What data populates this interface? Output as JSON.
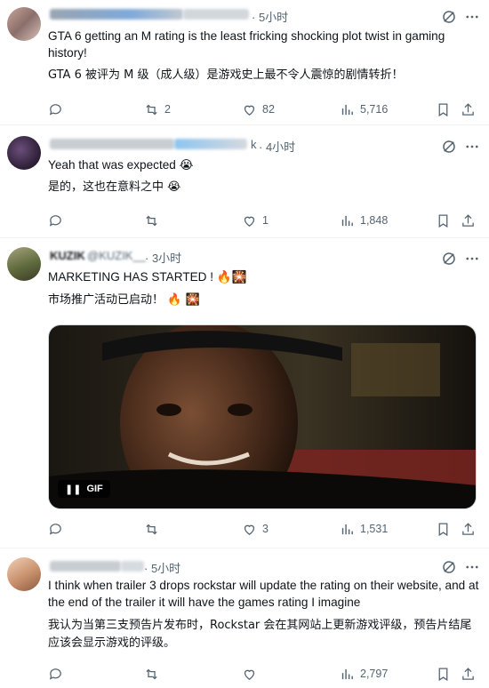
{
  "posts": [
    {
      "time": "· 5小时",
      "handle_partial": "Quantum",
      "text_en": "GTA 6 getting an M rating is the least fricking shocking plot twist in gaming history!",
      "text_cn": "GTA 6 被评为 M 级（成人级）是游戏史上最不令人震惊的剧情转折！",
      "replies": "",
      "reposts": "2",
      "likes": "82",
      "views": "5,716"
    },
    {
      "time": "· 4小时",
      "handle_partial": "k",
      "text_en": "Yeah that was expected 😭",
      "text_cn": "是的，这也在意料之中 😭",
      "replies": "",
      "reposts": "",
      "likes": "1",
      "views": "1,848"
    },
    {
      "display_name": "KUZIK",
      "handle": "@KUZIK__",
      "time": "· 3小时",
      "text_en": "MARKETING HAS STARTED ! 🔥🎇",
      "text_cn": "市场推广活动已启动！ 🔥 🎇",
      "gif_label": "GIF",
      "replies": "",
      "reposts": "",
      "likes": "3",
      "views": "1,531"
    },
    {
      "time": "· 5小时",
      "text_en": "I think when trailer 3 drops rockstar will update the rating on their website, and at the end of the trailer it will have the games rating I imagine",
      "text_cn": "我认为当第三支预告片发布时，Rockstar 会在其网站上更新游戏评级，预告片结尾应该会显示游戏的评级。",
      "replies": "",
      "reposts": "",
      "likes": "",
      "views": "2,797"
    }
  ],
  "icons": [
    "reply-icon",
    "repost-icon",
    "like-icon",
    "views-icon",
    "bookmark-icon",
    "share-icon",
    "grok-icon",
    "more-icon"
  ],
  "colors": {
    "text": "#0f1419",
    "muted": "#536471",
    "divider": "#eff3f4"
  }
}
